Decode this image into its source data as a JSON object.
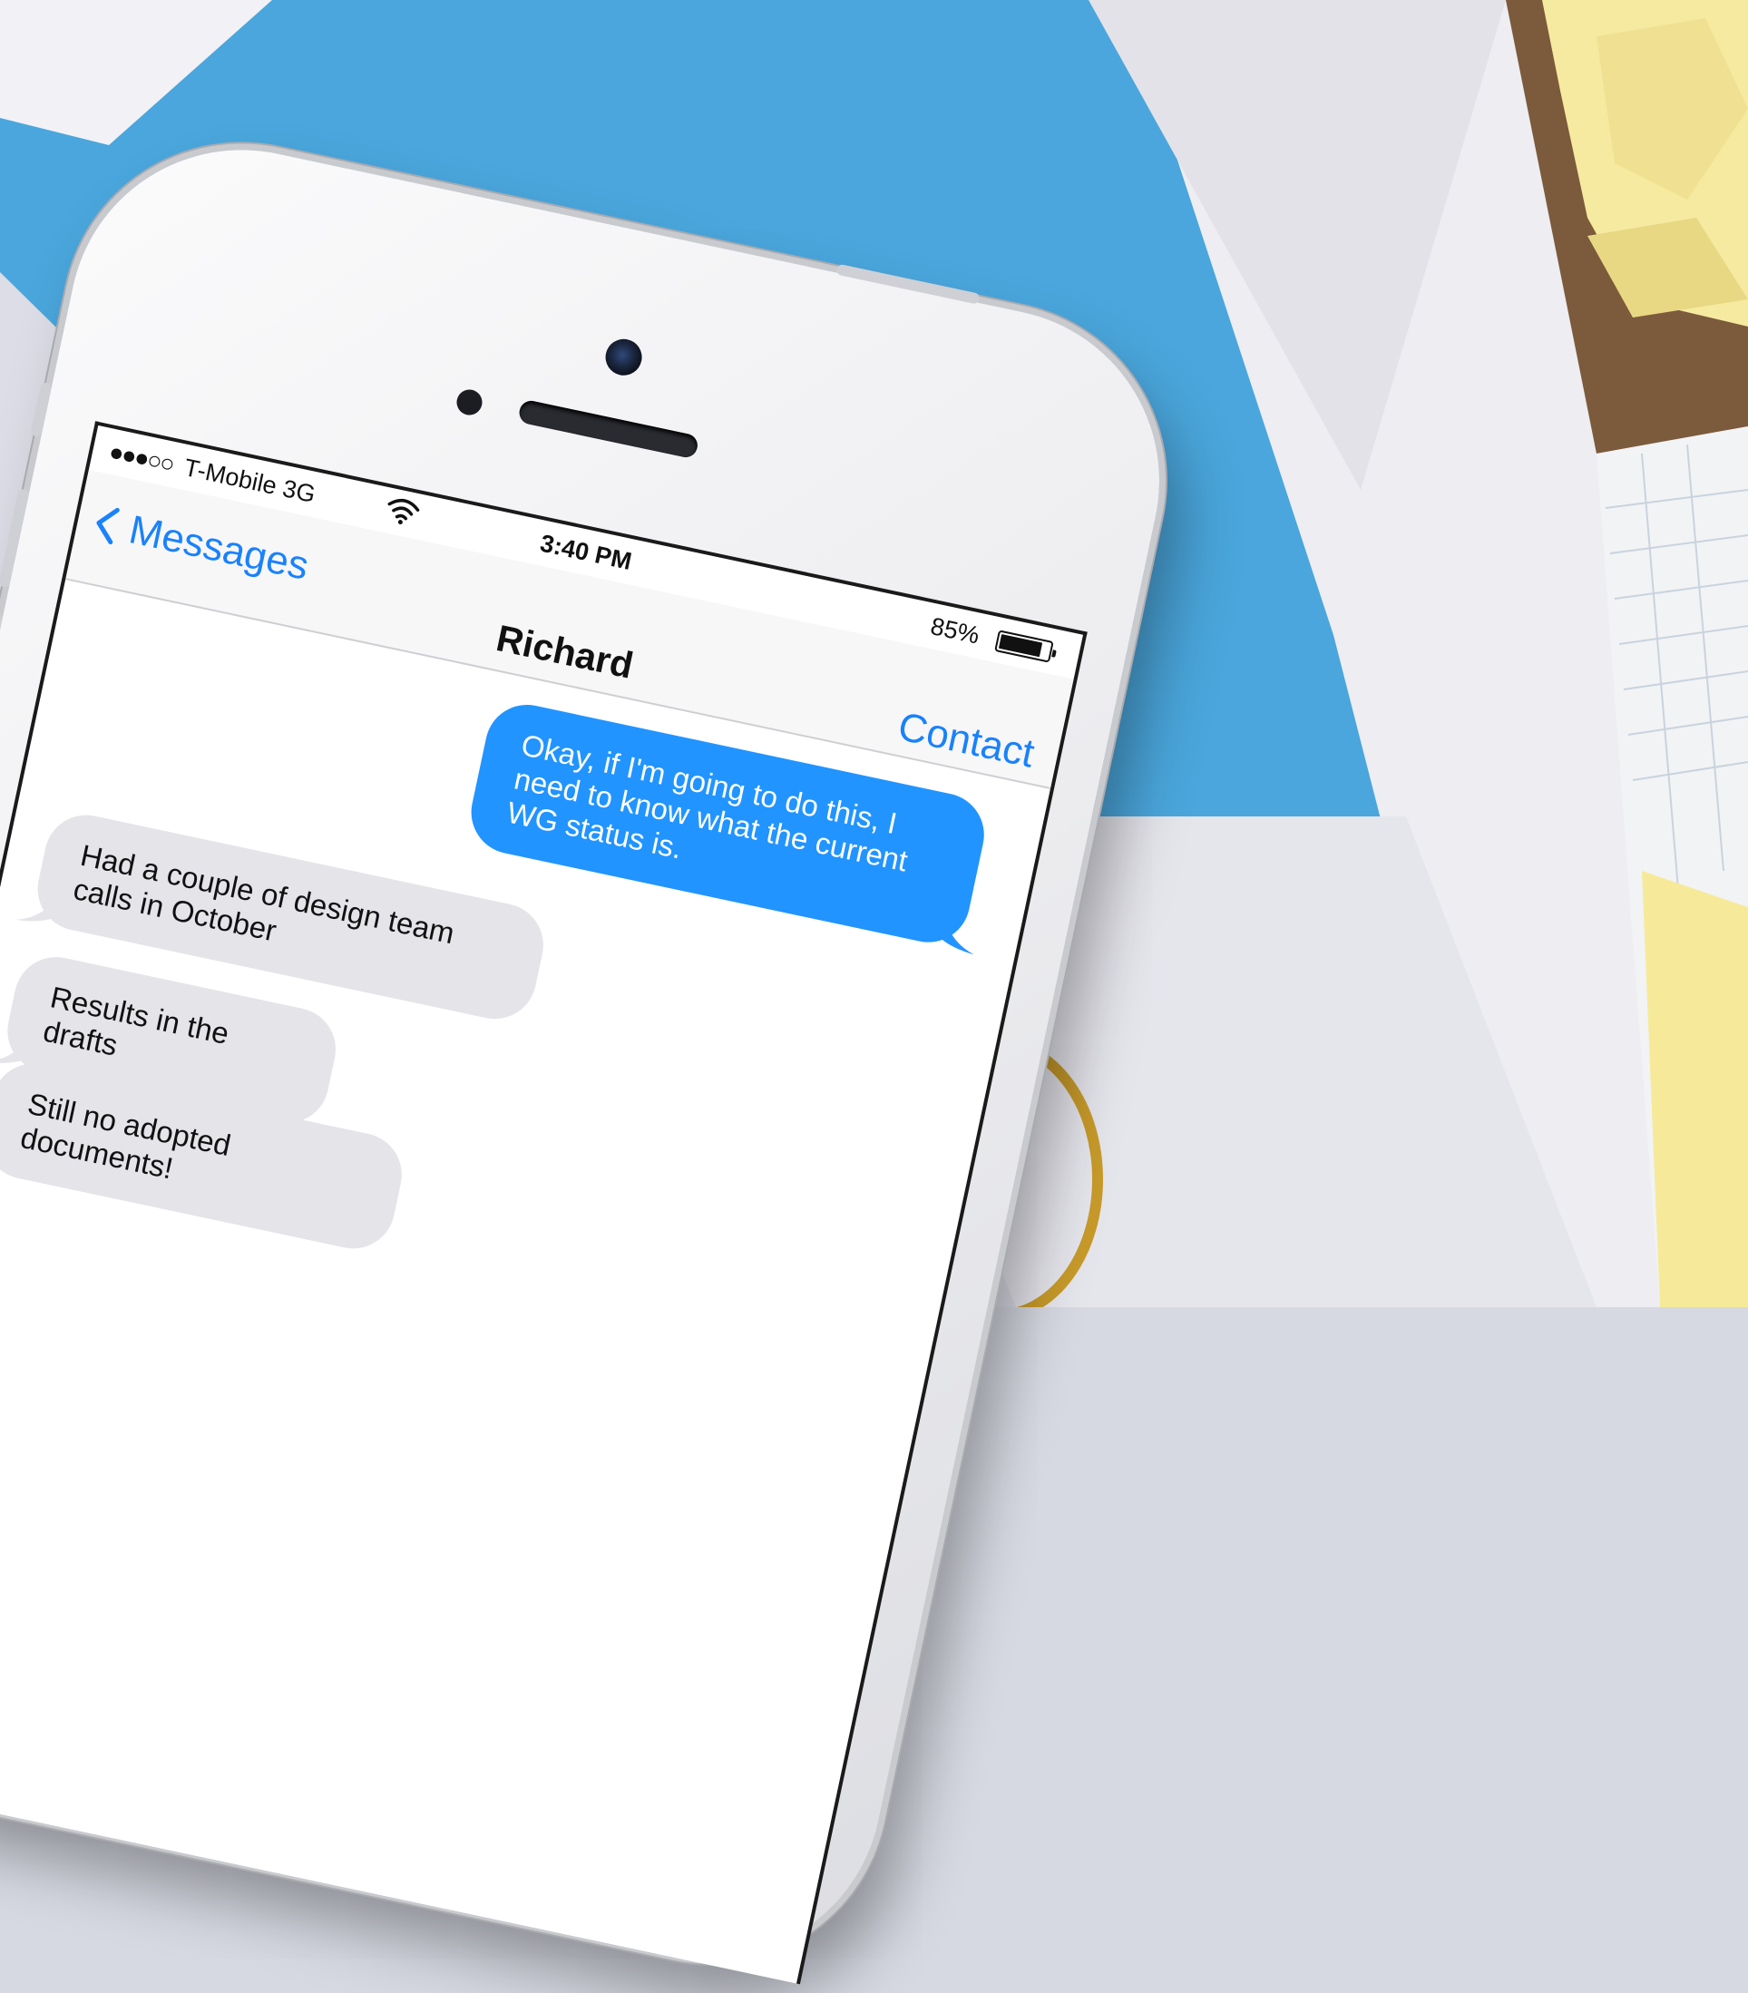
{
  "status_bar": {
    "signal": "●●●○○",
    "carrier": "T-Mobile 3G",
    "time": "3:40 PM",
    "battery_percent": "85%",
    "battery_level": 0.85
  },
  "nav": {
    "back_label": "Messages",
    "title": "Richard",
    "contact_label": "Contact"
  },
  "messages": [
    {
      "from": "me",
      "text": "Okay, if I'm going to do this, I need to know what the current WG status is."
    },
    {
      "from": "them",
      "text": "Had a couple of design team calls in October"
    },
    {
      "from": "them",
      "text": "Results in the drafts"
    },
    {
      "from": "them",
      "text": "Still no adopted documents!"
    }
  ],
  "colors": {
    "ios_blue": "#1a82fb",
    "sent_bubble": "#2194ff",
    "received_bubble": "#e4e4e9",
    "desk_blue": "#4aa6dc",
    "paper_yellow": "#f5e9a4"
  }
}
